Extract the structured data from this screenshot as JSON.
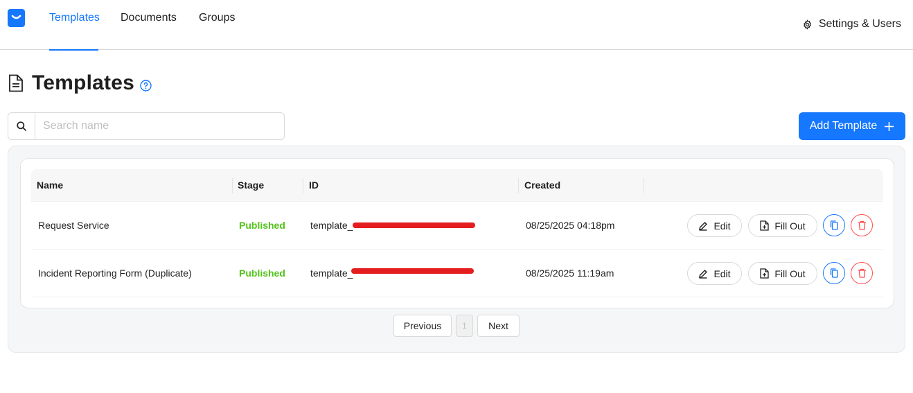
{
  "nav": {
    "tabs": [
      {
        "label": "Templates",
        "active": true
      },
      {
        "label": "Documents",
        "active": false
      },
      {
        "label": "Groups",
        "active": false
      }
    ],
    "settings_label": "Settings & Users"
  },
  "page": {
    "title": "Templates"
  },
  "search": {
    "placeholder": "Search name",
    "value": ""
  },
  "add_button_label": "Add Template",
  "table": {
    "columns": [
      "Name",
      "Stage",
      "ID",
      "Created"
    ],
    "rows": [
      {
        "name": "Request Service",
        "stage": "Published",
        "id": "template_",
        "created": "08/25/2025 04:18pm"
      },
      {
        "name": "Incident Reporting Form (Duplicate)",
        "stage": "Published",
        "id": "template_",
        "created": "08/25/2025 11:19am"
      }
    ],
    "actions": {
      "edit_label": "Edit",
      "fill_label": "Fill Out"
    }
  },
  "pagination": {
    "previous_label": "Previous",
    "current_page": "1",
    "next_label": "Next"
  },
  "colors": {
    "accent": "#1677ff",
    "published": "#52c41a",
    "danger": "#ff4d4f",
    "redaction": "#e41e1e"
  }
}
